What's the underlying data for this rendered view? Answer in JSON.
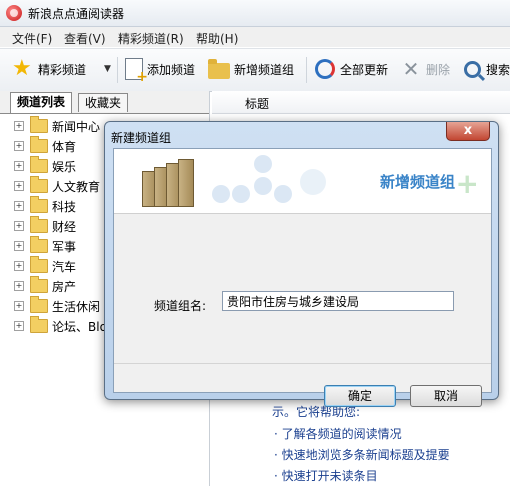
{
  "window": {
    "title": "新浪点点通阅读器"
  },
  "menubar": {
    "items": [
      "文件(F)",
      "查看(V)",
      "精彩频道(R)",
      "帮助(H)"
    ]
  },
  "toolbar": {
    "featured": "精彩频道",
    "add_channel": "添加频道",
    "new_group": "新增频道组",
    "update_all": "全部更新",
    "delete": "删除",
    "search": "搜索"
  },
  "left_panel": {
    "tabs": [
      "频道列表",
      "收藏夹"
    ],
    "tree": [
      "新闻中心",
      "体育",
      "娱乐",
      "人文教育",
      "科技",
      "财经",
      "军事",
      "汽车",
      "房产",
      "生活休闲",
      "论坛、Blog"
    ]
  },
  "right_panel": {
    "column_title": "标题",
    "info_line1": "示。它将帮助您:",
    "bullets": [
      "· 了解各频道的阅读情况",
      "· 快速地浏览多条新闻标题及提要",
      "· 快速打开未读条目"
    ]
  },
  "dialog": {
    "title": "新建频道组",
    "close": "x",
    "banner_title": "新增频道组",
    "field_label": "频道组名:",
    "field_value": "贵阳市住房与城乡建设局",
    "ok": "确定",
    "cancel": "取消"
  },
  "colors": {
    "banner_accent": "#3a84c8",
    "dialog_frame": "#b9d0ea",
    "close_red": "#c24632"
  }
}
